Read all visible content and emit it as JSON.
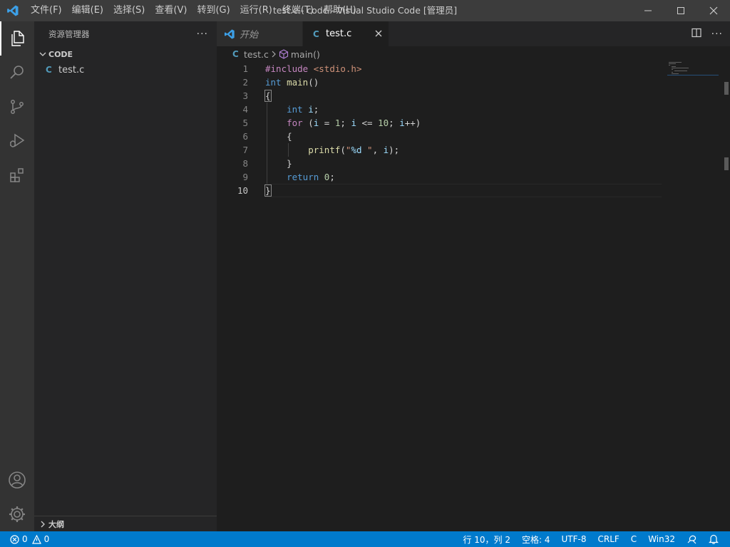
{
  "titlebar": {
    "menus": [
      "文件(F)",
      "编辑(E)",
      "选择(S)",
      "查看(V)",
      "转到(G)",
      "运行(R)",
      "终端(T)",
      "帮助(H)"
    ],
    "window_title": "test.c - code - Visual Studio Code [管理员]"
  },
  "activitybar": {
    "items": [
      "explorer-icon",
      "search-icon",
      "source-control-icon",
      "run-debug-icon",
      "extensions-icon"
    ],
    "bottom": [
      "account-icon",
      "manage-gear-icon"
    ]
  },
  "sidebar": {
    "title": "资源管理器",
    "more": "···",
    "section": "CODE",
    "files": [
      {
        "icon": "C",
        "name": "test.c"
      }
    ],
    "outline": "大纲"
  },
  "tabs": [
    {
      "label": "开始",
      "active": false
    },
    {
      "label": "test.c",
      "icon": "C",
      "active": true
    }
  ],
  "breadcrumb": {
    "file": "test.c",
    "file_icon": "C",
    "symbol": "main()"
  },
  "editor": {
    "line_numbers": [
      "1",
      "2",
      "3",
      "4",
      "5",
      "6",
      "7",
      "8",
      "9",
      "10"
    ],
    "current_line": 10,
    "lines": [
      "#include <stdio.h>",
      "int main()",
      "{",
      "    int i;",
      "    for (i = 1; i <= 10; i++)",
      "    {",
      "        printf(\"%d \", i);",
      "    }",
      "    return 0;",
      "}"
    ]
  },
  "statusbar": {
    "errors": "0",
    "warnings": "0",
    "position": "行 10，列 2",
    "indent": "空格: 4",
    "encoding": "UTF-8",
    "eol": "CRLF",
    "language": "C",
    "platform": "Win32"
  },
  "colors": {
    "accent": "#007acc",
    "keyword": "#569cd6",
    "control": "#c586c0",
    "string": "#ce9178",
    "function": "#dcdcaa",
    "variable": "#9cdcfe",
    "number": "#b5cea8"
  }
}
